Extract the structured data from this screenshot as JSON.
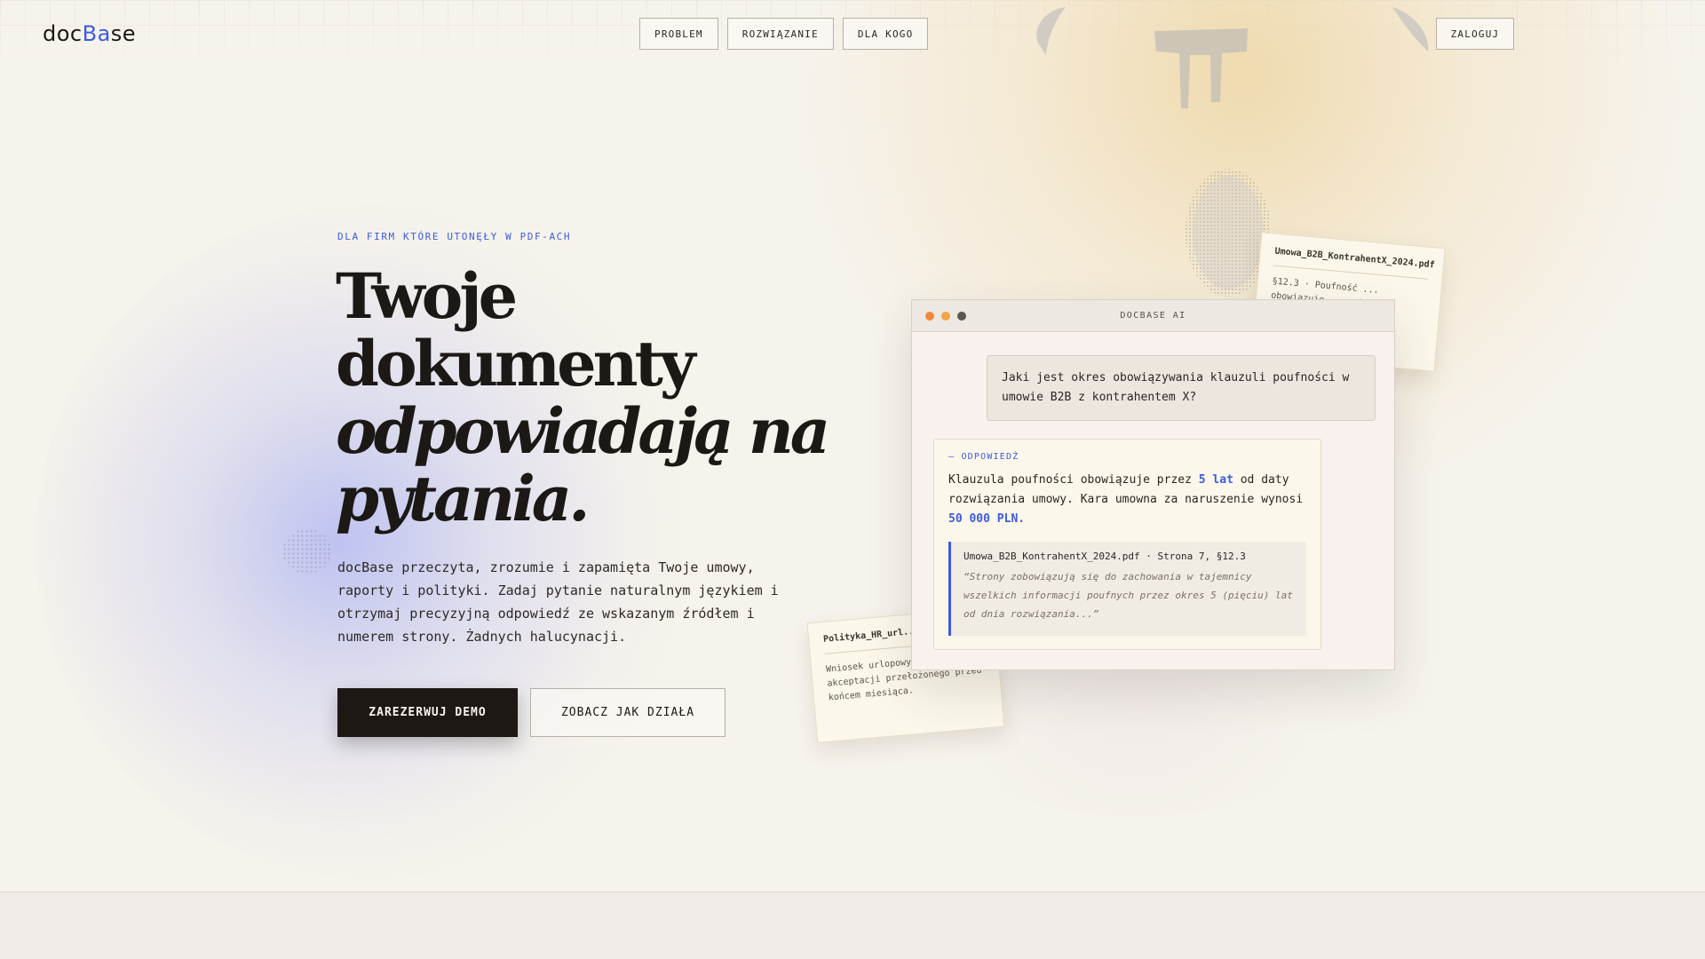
{
  "logo": {
    "text_prefix": "doc",
    "text_accent": "Ba",
    "text_suffix": "se"
  },
  "nav": {
    "items": [
      {
        "label": "PROBLEM"
      },
      {
        "label": "ROZWIĄZANIE"
      },
      {
        "label": "DLA KOGO"
      }
    ],
    "login_label": "ZALOGUJ"
  },
  "hero": {
    "eyebrow": "DLA FIRM KTÓRE UTONĘŁY W PDF-ACH",
    "headline": {
      "line1": "Twoje",
      "line2": "dokumenty",
      "line3": "odpowiadają na",
      "line4": "pytania."
    },
    "description": "docBase przeczyta, zrozumie i zapamięta Twoje umowy, raporty i polityki. Zadaj pytanie naturalnym językiem i otrzymaj precyzyjną odpowiedź ze wskazanym źródłem i numerem strony. Żadnych halucynacji.",
    "cta_primary": "ZAREZERWUJ DEMO",
    "cta_secondary": "ZOBACZ JAK DZIAŁA"
  },
  "doc_cards": [
    {
      "filename": "Umowa_B2B_KontrahentX_2024.pdf",
      "body": "§12.3 · Poufność ... obowiązuje ... od ..."
    },
    {
      "filename": "Polityka_HR_url...",
      "body": "Wniosek urlopowy ... akceptacji przełożonego przed końcem miesiąca."
    }
  ],
  "chat": {
    "window_title": "DOCBASE AI",
    "colors": {
      "dot_1": "#f0873a",
      "dot_2": "#f2a446",
      "dot_3": "#5b5650"
    },
    "user_question": "Jaki jest okres obowiązywania klauzuli poufności w umowie B2B z kontrahentem X?",
    "answer_label": "— ODPOWIEDŹ",
    "answer": {
      "part1": "Klauzula poufności obowiązuje przez ",
      "highlight1": "5 lat",
      "part2": " od daty rozwiązania umowy. Kara umowna za naruszenie wynosi ",
      "highlight2": "50 000 PLN",
      "part3": "."
    },
    "citation": {
      "source": "Umowa_B2B_KontrahentX_2024.pdf · Strona 7, §12.3",
      "quote": "“Strony zobowiązują się do zachowania w tajemnicy wszelkich informacji poufnych przez okres 5 (pięciu) lat od dnia rozwiązania...”"
    }
  },
  "colors": {
    "accent": "#3d5be0",
    "background": "#f6f3ec",
    "primary_button": "#1e1814"
  }
}
